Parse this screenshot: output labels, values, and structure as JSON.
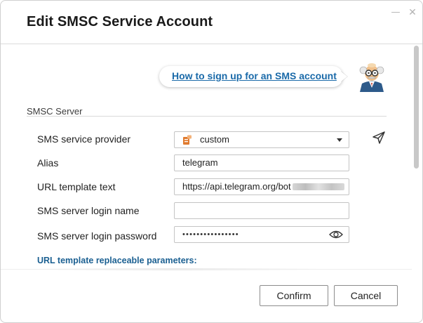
{
  "dialog": {
    "title": "Edit SMSC Service Account",
    "minimize_glyph": "—",
    "close_glyph": "✕"
  },
  "promo": {
    "link_text": "How to sign up for an SMS account",
    "mascot_icon": "professor-mascot-icon"
  },
  "section": {
    "title": "SMSC Server"
  },
  "form": {
    "provider": {
      "label": "SMS service provider",
      "value": "custom",
      "icon": "custom-provider-icon"
    },
    "alias": {
      "label": "Alias",
      "value": "telegram"
    },
    "url_template": {
      "label": "URL template text",
      "value": "https://api.telegram.org/bot"
    },
    "login_name": {
      "label": "SMS server login name",
      "value": ""
    },
    "login_password": {
      "label": "SMS server login password",
      "masked_value": "••••••••••••••••"
    },
    "send_test_icon": "paper-plane-icon",
    "params_link": "URL template replaceable parameters:"
  },
  "buttons": {
    "confirm": "Confirm",
    "cancel": "Cancel"
  },
  "colors": {
    "link": "#1a6aa9",
    "params_link": "#1a5f91"
  }
}
